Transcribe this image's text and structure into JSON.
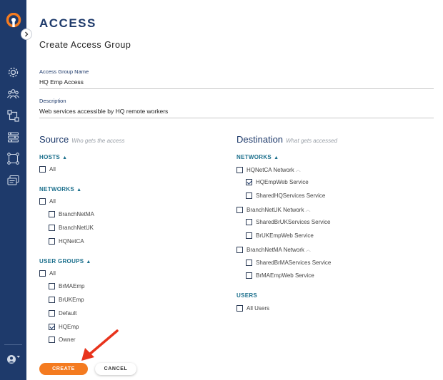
{
  "page": {
    "title": "ACCESS",
    "section_title": "Create Access Group"
  },
  "form": {
    "name_label": "Access Group Name",
    "name_value": "HQ Emp Access",
    "desc_label": "Description",
    "desc_value": "Web services accessible by HQ remote workers"
  },
  "source": {
    "title": "Source",
    "subtitle": "Who gets the access",
    "hosts": {
      "label": "HOSTS",
      "all": "All"
    },
    "networks": {
      "label": "NETWORKS",
      "all": "All",
      "items": [
        "BranchNetMA",
        "BranchNetUK",
        "HQNetCA"
      ]
    },
    "user_groups": {
      "label": "USER GROUPS",
      "all": "All",
      "items": [
        "BrMAEmp",
        "BrUKEmp",
        "Default",
        "HQEmp",
        "Owner"
      ],
      "checked": "HQEmp"
    }
  },
  "destination": {
    "title": "Destination",
    "subtitle": "What gets accessed",
    "networks_label": "NETWORKS",
    "networks": [
      {
        "name": "HQNetCA Network",
        "services": [
          "HQEmpWeb Service",
          "SharedHQServices Service"
        ]
      },
      {
        "name": "BranchNetUK Network",
        "services": [
          "SharedBrUKServices Service",
          "BrUKEmpWeb Service"
        ]
      },
      {
        "name": "BranchNetMA Network",
        "services": [
          "SharedBrMAServices Service",
          "BrMAEmpWeb Service"
        ]
      }
    ],
    "checked_service": "HQEmpWeb Service",
    "users_label": "USERS",
    "all_users": "All Users"
  },
  "buttons": {
    "create": "CREATE",
    "cancel": "CANCEL"
  },
  "colors": {
    "sidebar": "#1e3a6b",
    "accent": "#f47b20",
    "teal": "#1b6f8c"
  }
}
